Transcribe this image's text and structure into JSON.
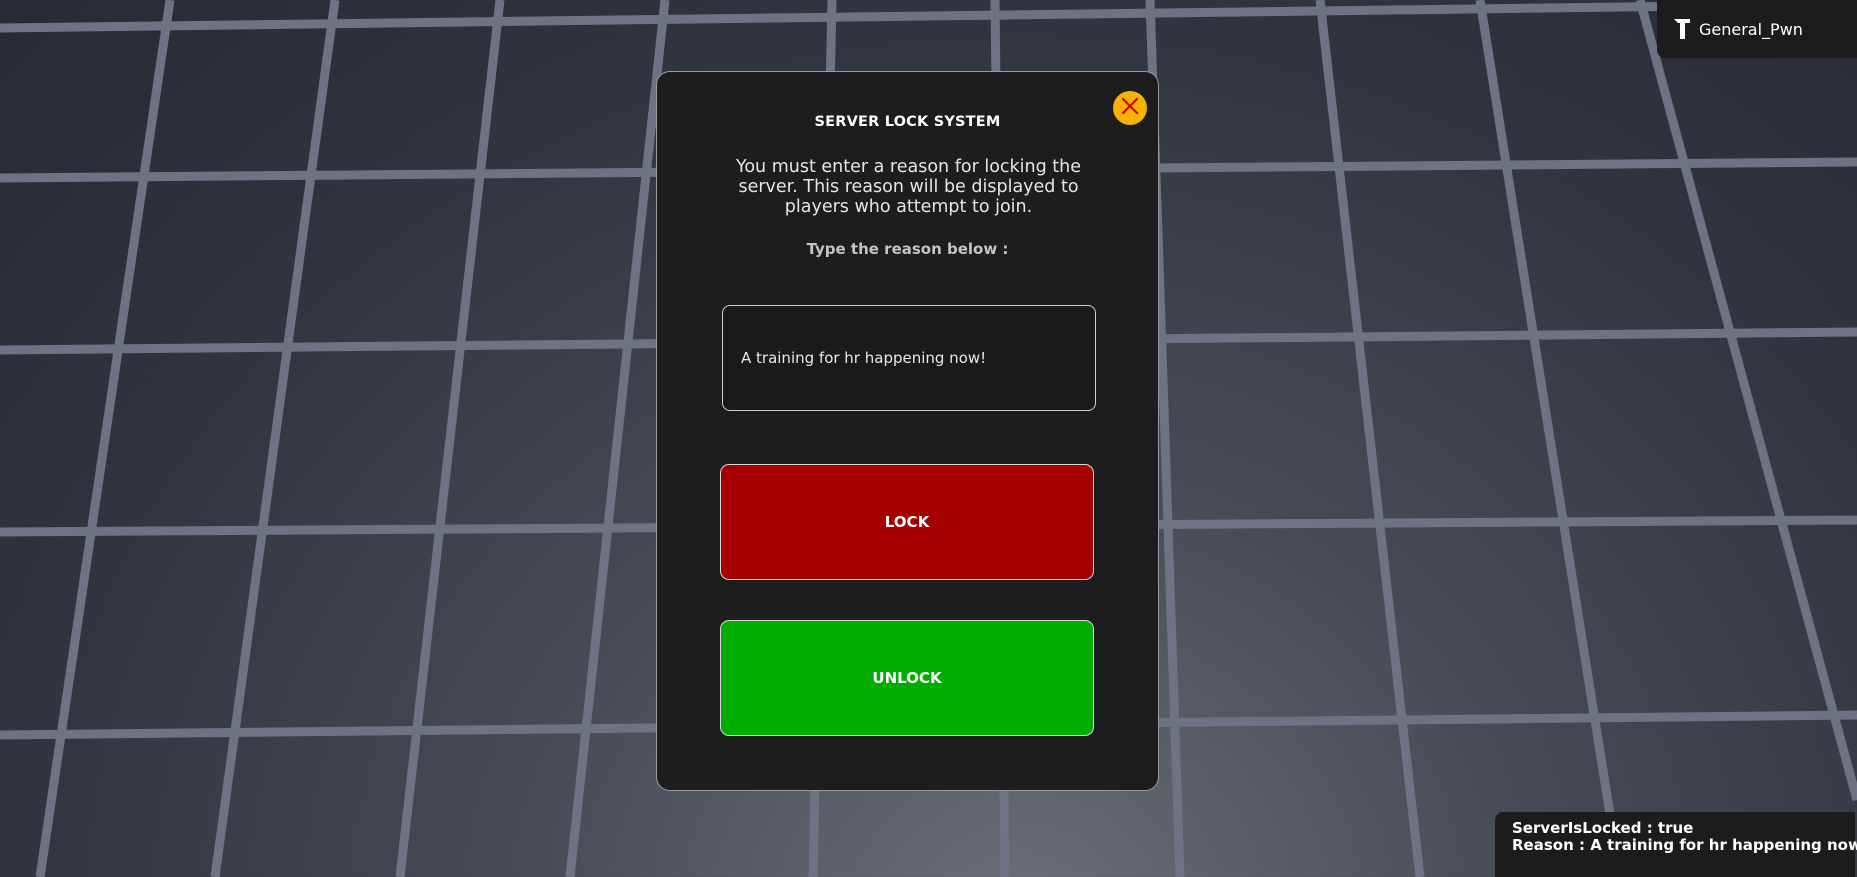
{
  "player": {
    "name": "General_Pwn",
    "icon": "hammer-icon"
  },
  "dialog": {
    "title": "SERVER LOCK SYSTEM",
    "description": "You must enter a reason for locking the server. This reason will be displayed to players who attempt to join.",
    "prompt": "Type the reason below :",
    "reason_value": "A training for hr happening now!",
    "lock_label": "LOCK",
    "unlock_label": "UNLOCK",
    "close_icon": "close-icon"
  },
  "status": {
    "locked_line": "ServerIsLocked : true",
    "reason_line": "Reason : A training for hr happening now!"
  },
  "colors": {
    "lock_button": "#a50000",
    "unlock_button": "#02ad02",
    "close_button": "#f6b200",
    "close_x": "#d40000",
    "panel_background": "#1d1d1f",
    "grid_line": "#6d7382"
  }
}
